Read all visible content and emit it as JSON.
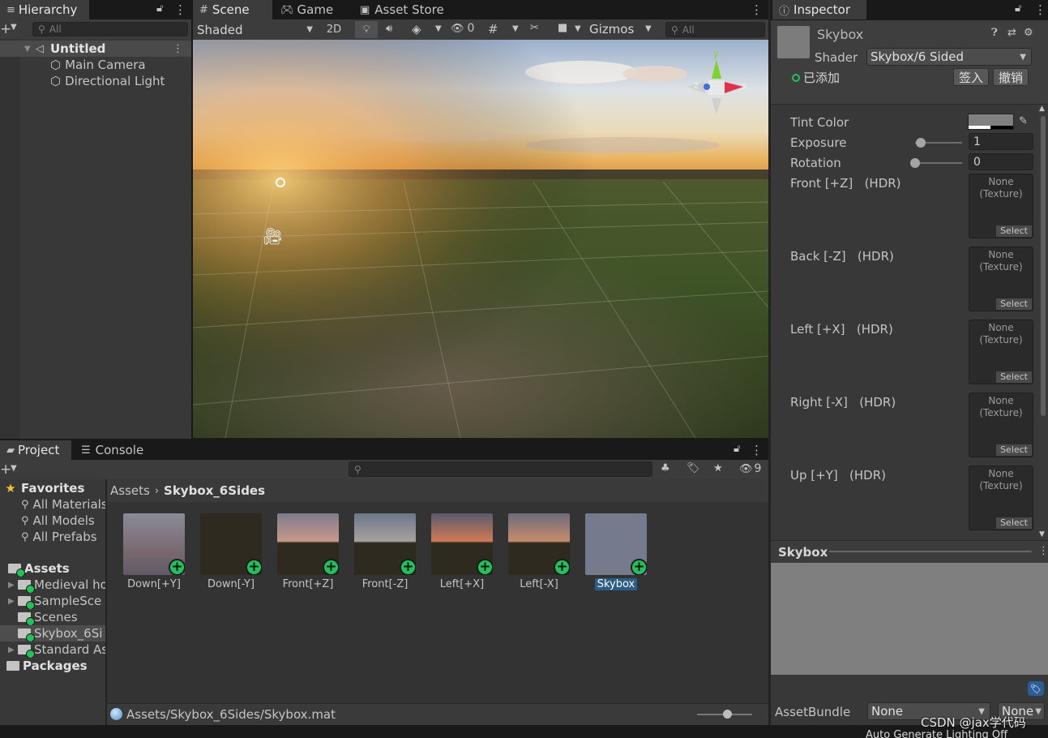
{
  "hierarchy": {
    "tab": "Hierarchy",
    "search_placeholder": "All",
    "scene_name": "Untitled",
    "items": [
      "Main Camera",
      "Directional Light"
    ]
  },
  "scene_view": {
    "tabs": [
      "Scene",
      "Game",
      "Asset Store"
    ],
    "shading_mode": "Shaded",
    "mode_2d": "2D",
    "hidden_count": "0",
    "gizmos": "Gizmos",
    "search_placeholder": "All",
    "gizmo_axes": {
      "y": "y",
      "x": "x",
      "z": "z"
    }
  },
  "project": {
    "tabs": [
      "Project",
      "Console"
    ],
    "hidden_count": "9",
    "favorites_label": "Favorites",
    "favorites": [
      "All Materials",
      "All Models",
      "All Prefabs"
    ],
    "assets_label": "Assets",
    "asset_folders": [
      "Medieval ho",
      "SampleSce",
      "Scenes",
      "Skybox_6Si",
      "Standard As"
    ],
    "packages_label": "Packages",
    "breadcrumb": [
      "Assets",
      "Skybox_6Sides"
    ],
    "files": [
      "Down[+Y]",
      "Down[-Y]",
      "Front[+Z]",
      "Front[-Z]",
      "Left[+X]",
      "Left[-X]",
      "Skybox"
    ],
    "selected_file": "Skybox",
    "status_path": "Assets/Skybox_6Sides/Skybox.mat",
    "thumbnail_size_fraction": 0.55
  },
  "inspector": {
    "tab": "Inspector",
    "material_name": "Skybox",
    "shader_label": "Shader",
    "shader_value": "Skybox/6 Sided",
    "added_label": "已添加",
    "checkin_button": "签入",
    "revert_button": "撤销",
    "tint_color_label": "Tint Color",
    "tint_color": "#808080",
    "exposure_label": "Exposure",
    "exposure_value": "1",
    "exposure_slider_fraction": 0.125,
    "rotation_label": "Rotation",
    "rotation_value": "0",
    "rotation_slider_fraction": 0.0,
    "textures": [
      {
        "label": "Front [+Z]",
        "hdr": "(HDR)"
      },
      {
        "label": "Back [-Z]",
        "hdr": "(HDR)"
      },
      {
        "label": "Left [+X]",
        "hdr": "(HDR)"
      },
      {
        "label": "Right [-X]",
        "hdr": "(HDR)"
      },
      {
        "label": "Up [+Y]",
        "hdr": "(HDR)"
      }
    ],
    "texture_none_line1": "None",
    "texture_none_line2": "(Texture)",
    "texture_select": "Select",
    "preview_title": "Skybox",
    "assetbundle_label": "AssetBundle",
    "assetbundle_value": "None",
    "assetbundle_variant": "None",
    "footer_text": "Auto Generate Lighting Off"
  },
  "watermark": "CSDN @jax学代码",
  "colors": {
    "accent_blue": "#3a79bb",
    "add_badge_green": "#22c25a",
    "panel_bg": "#383838",
    "toolbar_bg": "#3c3c3c",
    "selected_label_bg": "#2c5d87"
  }
}
